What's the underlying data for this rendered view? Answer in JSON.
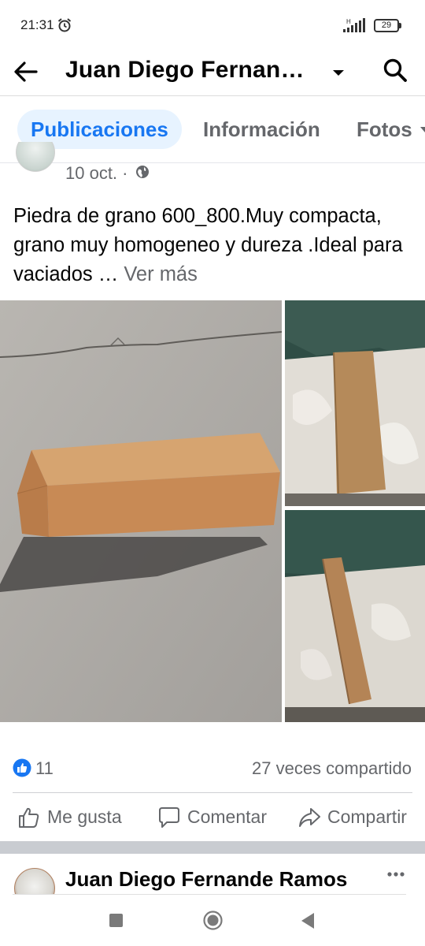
{
  "status_bar": {
    "time": "21:31",
    "network_label": "H",
    "battery_level": "29"
  },
  "header": {
    "page_name": "Juan Diego Fernande..."
  },
  "tabs": [
    {
      "label": "Publicaciones",
      "active": true
    },
    {
      "label": "Información",
      "active": false
    },
    {
      "label": "Fotos",
      "active": false
    }
  ],
  "post": {
    "date": "10 oct. ·",
    "text": "Piedra de grano 600_800.Muy compacta, grano muy homogeneo y dureza .Ideal para vaciados …",
    "see_more": "Ver más",
    "like_count": "11",
    "share_count": "27 veces compartido",
    "actions": {
      "like": "Me gusta",
      "comment": "Comentar",
      "share": "Compartir"
    }
  },
  "next_post": {
    "author": "Juan Diego Fernande Ramos"
  },
  "colors": {
    "accent": "#1877f2",
    "tab_active_bg": "#e7f3ff",
    "secondary_text": "#65676b",
    "separator": "#c9ccd1"
  },
  "icons": [
    "alarm-icon",
    "signal-icon",
    "battery-icon",
    "back-arrow-icon",
    "dropdown-caret-icon",
    "search-icon",
    "globe-icon",
    "like-badge-icon",
    "thumbs-up-icon",
    "comment-icon",
    "share-arrow-icon",
    "more-dots-icon"
  ]
}
